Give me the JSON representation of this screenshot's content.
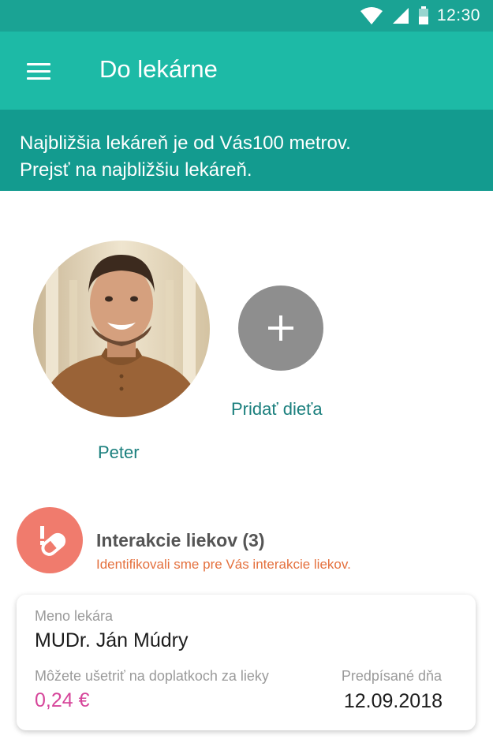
{
  "status_bar": {
    "time": "12:30",
    "icons": [
      "wifi-icon",
      "signal-icon",
      "battery-icon"
    ]
  },
  "app_bar": {
    "title": "Do lekárne",
    "menu_icon": "menu-icon"
  },
  "banner": {
    "line1": "Najbližšia lekáreň je od Vás100 metrov.",
    "line2": "Prejsť na najbližšiu lekáreň."
  },
  "profiles": {
    "main": {
      "name": "Peter"
    },
    "add_child": {
      "label": "Pridať dieťa",
      "icon": "plus-icon"
    }
  },
  "interactions": {
    "title": "Interakcie liekov (3)",
    "subtitle": "Identifikovali sme pre Vás interakcie liekov.",
    "icon": "pill-alert-icon"
  },
  "prescription_card": {
    "doctor_label": "Meno lekára",
    "doctor_name": "MUDr. Ján Múdry",
    "savings_label": "Môžete ušetriť na doplatkoch za lieky",
    "savings_amount": "0,24 €",
    "prescribed_label": "Predpísané dňa",
    "prescribed_date": "12.09.2018"
  },
  "colors": {
    "status_bar": "#1aa394",
    "app_bar": "#1dbaa6",
    "banner": "#139b8f",
    "link_teal": "#1a7f7d",
    "alert_coral": "#f07b6d",
    "alert_text": "#e4703d",
    "price_pink": "#d6459a"
  }
}
